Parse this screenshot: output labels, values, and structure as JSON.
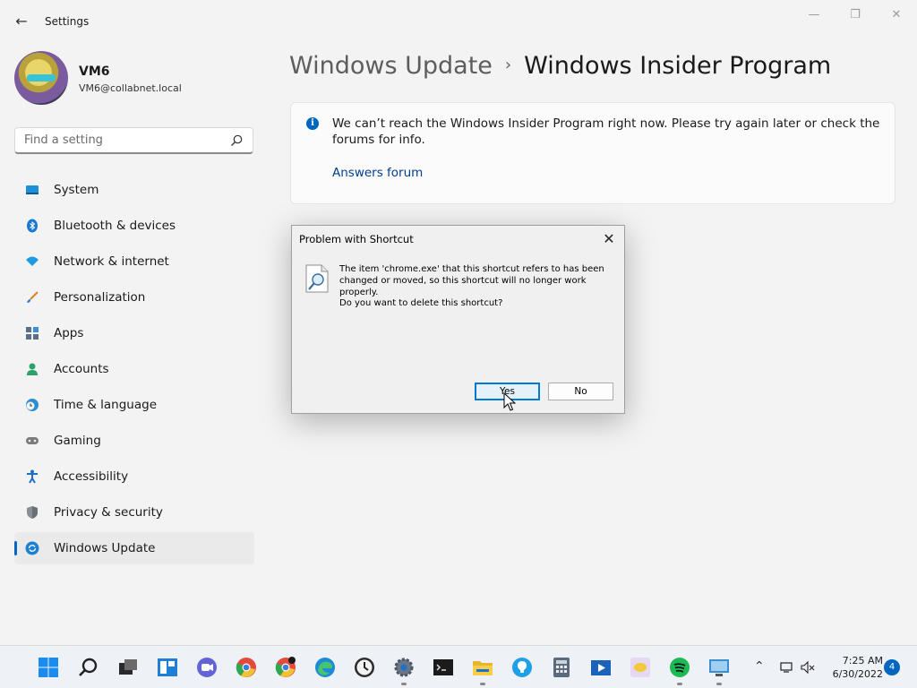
{
  "window": {
    "title": "Settings"
  },
  "profile": {
    "name": "VM6",
    "email": "VM6@collabnet.local"
  },
  "search": {
    "placeholder": "Find a setting"
  },
  "sidebar": {
    "items": [
      {
        "label": "System",
        "icon": "system-icon"
      },
      {
        "label": "Bluetooth & devices",
        "icon": "bluetooth-icon"
      },
      {
        "label": "Network & internet",
        "icon": "wifi-icon"
      },
      {
        "label": "Personalization",
        "icon": "brush-icon"
      },
      {
        "label": "Apps",
        "icon": "apps-icon"
      },
      {
        "label": "Accounts",
        "icon": "accounts-icon"
      },
      {
        "label": "Time & language",
        "icon": "clock-globe-icon"
      },
      {
        "label": "Gaming",
        "icon": "gamepad-icon"
      },
      {
        "label": "Accessibility",
        "icon": "accessibility-icon"
      },
      {
        "label": "Privacy & security",
        "icon": "shield-icon"
      },
      {
        "label": "Windows Update",
        "icon": "update-icon",
        "selected": true
      }
    ]
  },
  "breadcrumb": {
    "parent": "Windows Update",
    "separator": "›",
    "current": "Windows Insider Program"
  },
  "info_card": {
    "message": "We can’t reach the Windows Insider Program right now. Please try again later or check the forums for info.",
    "link": "Answers forum"
  },
  "dialog": {
    "title": "Problem with Shortcut",
    "message": "The item 'chrome.exe' that this shortcut refers to has been changed or moved, so this shortcut will no longer work properly.",
    "question": "Do you want to delete this shortcut?",
    "yes_label": "Yes",
    "no_label": "No"
  },
  "taskbar": {
    "time": "7:25 AM",
    "date": "6/30/2022",
    "notification_count": "4",
    "apps": [
      "start-icon",
      "search-icon",
      "task-view-icon",
      "widgets-icon",
      "teams-chat-icon",
      "chrome-icon",
      "chrome-profile-icon",
      "edge-icon",
      "clock-app-icon",
      "settings-icon",
      "terminal-icon",
      "file-explorer-icon",
      "lightbulb-icon",
      "calculator-icon",
      "media-player-icon",
      "sticky-icon",
      "spotify-icon",
      "remote-desktop-icon"
    ]
  },
  "colors": {
    "accent": "#0067c0",
    "link": "#003e92",
    "background": "#f3f3f3"
  }
}
